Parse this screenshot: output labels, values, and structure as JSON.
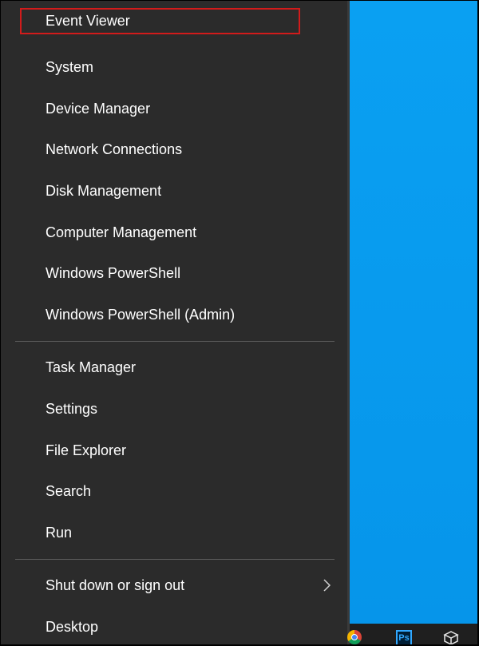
{
  "menu": {
    "items_group1": [
      {
        "label": "Event Viewer",
        "highlighted": true
      },
      {
        "label": "System"
      },
      {
        "label": "Device Manager"
      },
      {
        "label": "Network Connections"
      },
      {
        "label": "Disk Management"
      },
      {
        "label": "Computer Management"
      },
      {
        "label": "Windows PowerShell"
      },
      {
        "label": "Windows PowerShell (Admin)"
      }
    ],
    "items_group2": [
      {
        "label": "Task Manager"
      },
      {
        "label": "Settings"
      },
      {
        "label": "File Explorer"
      },
      {
        "label": "Search"
      },
      {
        "label": "Run"
      }
    ],
    "items_group3": [
      {
        "label": "Shut down or sign out",
        "has_submenu": true
      },
      {
        "label": "Desktop"
      }
    ],
    "highlight_color": "#d21b1b",
    "background_color": "#2b2b2b"
  },
  "taskbar": {
    "icons": [
      {
        "name": "chrome-icon"
      },
      {
        "name": "photoshop-icon",
        "text": "Ps"
      },
      {
        "name": "box-3d-icon"
      }
    ]
  },
  "colors": {
    "desktop": "#0a9ef0"
  }
}
